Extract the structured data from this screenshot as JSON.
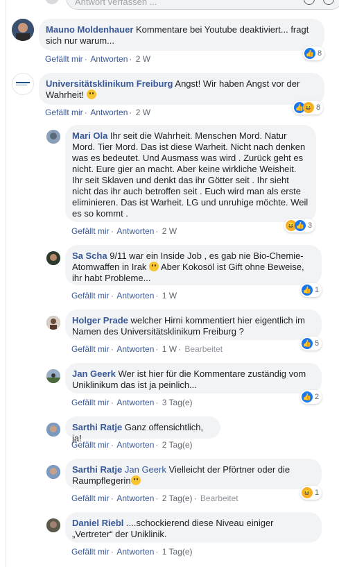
{
  "composer": {
    "placeholder": "Antwort verfassen ..."
  },
  "comments": [
    {
      "author": "Mauno Moldenhauer",
      "text": "Kommentare bei Youtube deaktiviert... fragt sich nur warum...",
      "like": "Gefällt mir",
      "reply": "Antworten",
      "time": "2 W",
      "reactions": [
        "like"
      ],
      "count": "8",
      "avatar_color": "#6b4a3a"
    },
    {
      "author": "Universitätsklinikum Freiburg",
      "text": "Angst! Wir haben Angst vor der Wahrheit!",
      "like": "Gefällt mir",
      "reply": "Antworten",
      "time": "2 W",
      "reactions": [
        "like",
        "haha"
      ],
      "count": "8",
      "avatar_color": "#ffffff"
    },
    {
      "author": "Mari Ola",
      "text": "Ihr seit die Wahrheit. Menschen Mord. Natur Mord. Tier Mord. Das ist diese Warheit. Nicht nach denken was es bedeutet. Und Ausmass was wird . Zurück geht es nicht. Eure gier an macht. Aber keine wirkliche Weisheit. Ihr seit Sklaven und denkt das ihr Götter seit . Ihr sieht nicht das ihr auch betroffen seit . Euch wird man als erste eliminieren. Das ist Warheit. LG und unruhige möchte. Weil es so kommt .",
      "like": "Gefällt mir",
      "reply": "Antworten",
      "time": "2 W",
      "reactions": [
        "haha",
        "like"
      ],
      "count": "3",
      "avatar_color": "#7a8aa0"
    },
    {
      "author": "Sa Scha",
      "text_a": "9/11 war ein Inside Job , es gab nie Bio-Chemie-Atomwaffen in Irak",
      "text_b": "Aber Kokosöl ist Gift ohne Beweise, ihr habt Probleme...",
      "like": "Gefällt mir",
      "reply": "Antworten",
      "time": "1 W",
      "reactions": [
        "like"
      ],
      "count": "1",
      "avatar_color": "#3a3a3a"
    },
    {
      "author": "Holger Prade",
      "text": "welcher Hirni kommentiert hier eigentlich im Namen des Universitätsklinikum Freiburg ?",
      "like": "Gefällt mir",
      "reply": "Antworten",
      "time": "1 W",
      "edited": "Bearbeitet",
      "reactions": [
        "like"
      ],
      "count": "5",
      "avatar_color": "#5a4030"
    },
    {
      "author": "Jan Geerk",
      "text": "Wer ist hier für die Kommentare zuständig vom Uniklinikum das ist ja peinlich...",
      "like": "Gefällt mir",
      "reply": "Antworten",
      "time": "3 Tag(e)",
      "reactions": [
        "like"
      ],
      "count": "2",
      "avatar_color": "#5a7a4a"
    },
    {
      "author": "Sarthi Ratje",
      "text": "Ganz offensichtlich, ja!",
      "like": "Gefällt mir",
      "reply": "Antworten",
      "time": "2 Tag(e)",
      "avatar_color": "#8a6a5a"
    },
    {
      "author": "Sarthi Ratje",
      "mention": "Jan Geerk",
      "text": "Vielleicht der Pförtner oder die Raumpflegerin",
      "like": "Gefällt mir",
      "reply": "Antworten",
      "time": "2 Tag(e)",
      "edited": "Bearbeitet",
      "reactions": [
        "haha"
      ],
      "count": "1",
      "avatar_color": "#8a6a5a"
    },
    {
      "author": "Daniel Riebl",
      "text": "....schockierend diese Niveau einiger „Vertreter“ der Uniklinik.",
      "like": "Gefällt mir",
      "reply": "Antworten",
      "time": "1 Tag(e)",
      "avatar_color": "#4a4a3a"
    }
  ]
}
